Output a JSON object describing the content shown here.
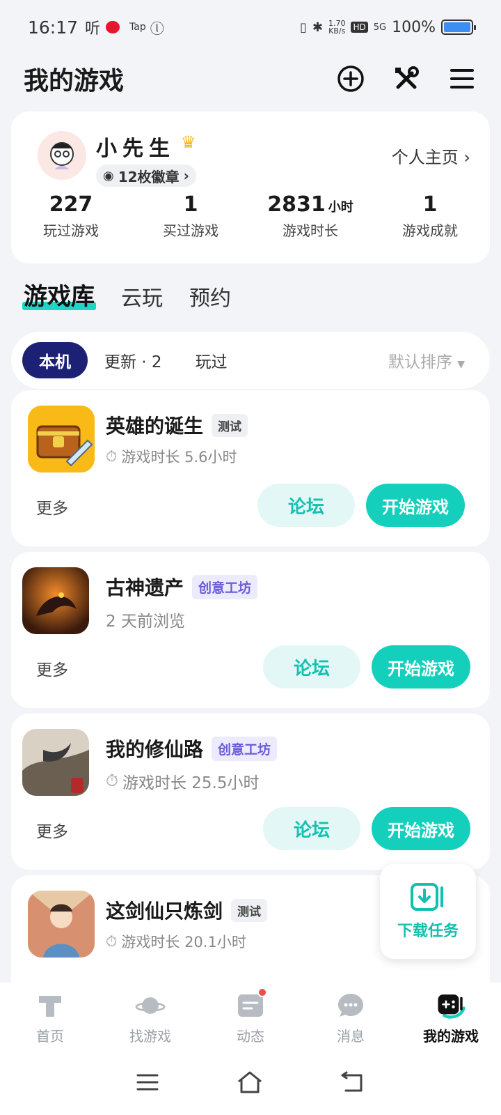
{
  "status_bar": {
    "time": "16:17",
    "left_icons": [
      "听",
      "weibo-icon",
      "Tap",
      "ⓛ"
    ],
    "speed_value": "1.70",
    "speed_unit": "KB/s",
    "hd": "HD",
    "network": "5G",
    "battery": "100%",
    "battery_level": 1.0
  },
  "header": {
    "title": "我的游戏",
    "icons": [
      "add-circle-icon",
      "tools-icon",
      "menu-icon"
    ]
  },
  "profile": {
    "name": "小先生",
    "badge": "12枚徽章",
    "homepage_link": "个人主页",
    "stats": [
      {
        "value": "227",
        "unit": "",
        "label": "玩过游戏"
      },
      {
        "value": "1",
        "unit": "",
        "label": "买过游戏"
      },
      {
        "value": "2831",
        "unit": "小时",
        "label": "游戏时长"
      },
      {
        "value": "1",
        "unit": "",
        "label": "游戏成就"
      }
    ]
  },
  "library_tabs": [
    "游戏库",
    "云玩",
    "预约"
  ],
  "filters": {
    "chips": [
      "本机",
      "更新 · 2",
      "玩过"
    ],
    "sort": "默认排序"
  },
  "games": [
    {
      "name": "英雄的诞生",
      "tag": "测试",
      "tag_type": "test",
      "subtitle": "游戏时长 5.6小时",
      "has_timer": true,
      "more": "更多",
      "forum": "论坛",
      "play": "开始游戏"
    },
    {
      "name": "古神遗产",
      "tag": "创意工坊",
      "tag_type": "workshop",
      "subtitle": "2 天前浏览",
      "has_timer": false,
      "more": "更多",
      "forum": "论坛",
      "play": "开始游戏"
    },
    {
      "name": "我的修仙路",
      "tag": "创意工坊",
      "tag_type": "workshop",
      "subtitle": "游戏时长 25.5小时",
      "has_timer": true,
      "more": "更多",
      "forum": "论坛",
      "play": "开始游戏"
    },
    {
      "name": "这剑仙只炼剑",
      "tag": "测试",
      "tag_type": "test",
      "subtitle": "游戏时长 20.1小时",
      "has_timer": true
    }
  ],
  "download_task": "下载任务",
  "bottom_nav": [
    {
      "label": "首页",
      "icon": "home-t-icon"
    },
    {
      "label": "找游戏",
      "icon": "planet-icon"
    },
    {
      "label": "动态",
      "icon": "feed-icon",
      "dot": true
    },
    {
      "label": "消息",
      "icon": "message-icon"
    },
    {
      "label": "我的游戏",
      "icon": "gamepad-icon",
      "active": true
    }
  ],
  "colors": {
    "accent": "#15cfbd",
    "chip_active": "#1c2175",
    "forum_bg": "#e3f8f6"
  }
}
